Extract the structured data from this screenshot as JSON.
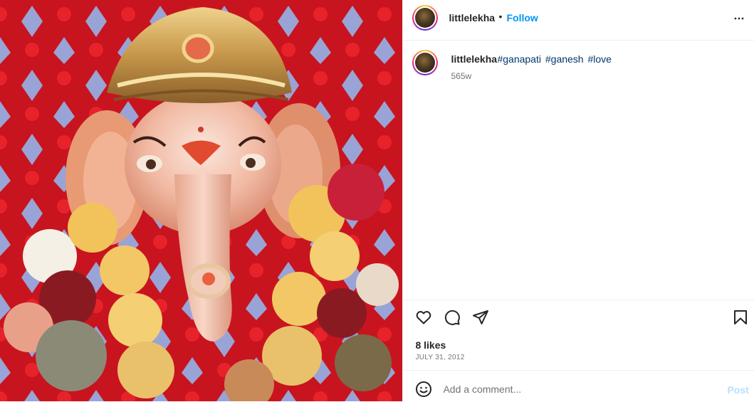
{
  "header": {
    "username": "littlelekha",
    "separator": "•",
    "follow_label": "Follow",
    "more_icon": "more-horizontal-icon"
  },
  "caption": {
    "username": "littlelekha",
    "hashtags": [
      "#ganapati",
      "#ganesh",
      "#love"
    ],
    "time_ago": "565w"
  },
  "actions": {
    "like_icon": "heart-icon",
    "comment_icon": "comment-icon",
    "share_icon": "send-icon",
    "save_icon": "bookmark-icon"
  },
  "likes": "8 likes",
  "date": "JULY 31, 2012",
  "comment": {
    "placeholder": "Add a comment...",
    "post_label": "Post",
    "emoji_icon": "smiley-icon"
  },
  "colors": {
    "accent": "#0095f6",
    "hashtag": "#00376b",
    "muted": "#737373",
    "post_disabled": "#b9dffc"
  }
}
